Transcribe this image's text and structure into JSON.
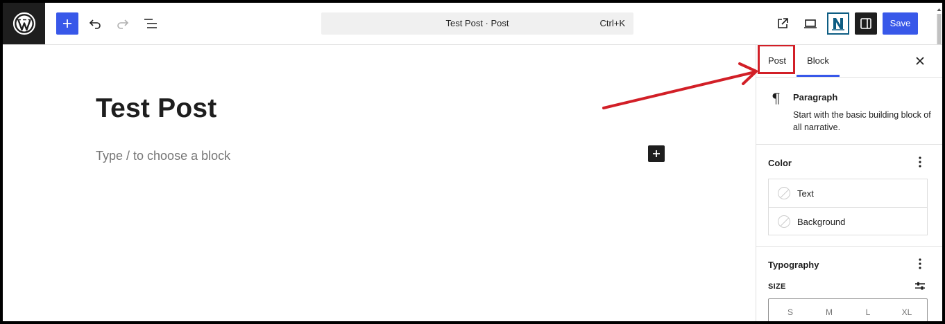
{
  "topbar": {
    "command_title": "Test Post · Post",
    "command_shortcut": "Ctrl+K",
    "save_label": "Save",
    "n_plugin_letter": "N"
  },
  "editor": {
    "post_title": "Test Post",
    "block_placeholder": "Type / to choose a block"
  },
  "sidebar": {
    "tabs": [
      {
        "label": "Post",
        "highlighted": true
      },
      {
        "label": "Block",
        "active": true
      }
    ],
    "block_card": {
      "name": "Paragraph",
      "description": "Start with the basic building block of all narrative."
    },
    "color_panel": {
      "title": "Color",
      "items": [
        "Text",
        "Background"
      ]
    },
    "typography_panel": {
      "title": "Typography",
      "size_label": "SIZE",
      "sizes": [
        "S",
        "M",
        "L",
        "XL"
      ]
    }
  },
  "colors": {
    "accent": "#3858e9",
    "dark": "#1e1e1e",
    "annotation": "#d21f27",
    "plugin": "#0d5d83"
  },
  "icons": [
    "wordpress-logo-icon",
    "plus-icon",
    "undo-icon",
    "redo-icon",
    "list-view-icon",
    "external-link-icon",
    "desktop-preview-icon",
    "sidebar-icon",
    "close-icon",
    "pilcrow-icon",
    "kebab-menu-icon",
    "sliders-icon"
  ]
}
